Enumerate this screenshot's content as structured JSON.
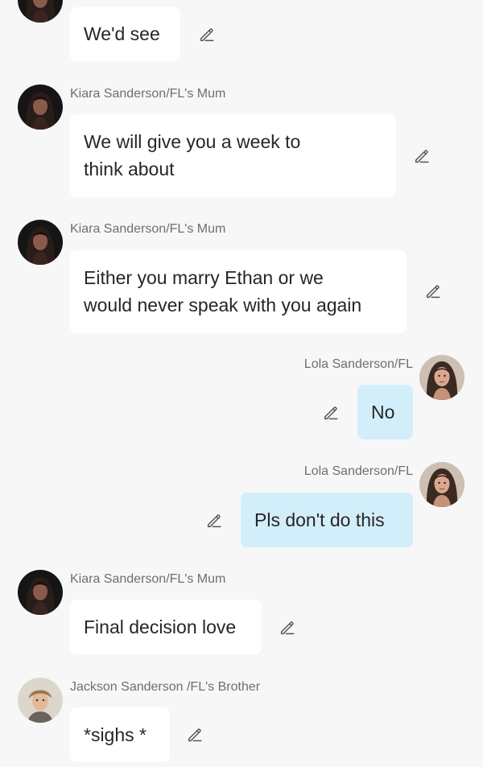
{
  "messages": [
    {
      "id": "m1",
      "side": "left",
      "sender": "",
      "text": "We'd see",
      "avatar_icon": "dark-hair-avatar-icon",
      "edit_icon": "pencil-edit-icon"
    },
    {
      "id": "m2",
      "side": "left",
      "sender": "Kiara Sanderson/FL's Mum",
      "text_lines": [
        "We will give you a week to",
        "think about"
      ],
      "avatar_icon": "dark-hair-woman-avatar-icon",
      "edit_icon": "pencil-edit-icon"
    },
    {
      "id": "m3",
      "side": "left",
      "sender": "Kiara Sanderson/FL's Mum",
      "text_lines": [
        "Either you marry Ethan or we",
        "would never speak with you again"
      ],
      "avatar_icon": "dark-hair-woman-avatar-icon",
      "edit_icon": "pencil-edit-icon"
    },
    {
      "id": "m4",
      "side": "right",
      "sender": "Lola Sanderson/FL",
      "text": "No",
      "avatar_icon": "brunette-woman-avatar-icon",
      "edit_icon": "pencil-edit-icon"
    },
    {
      "id": "m5",
      "side": "right",
      "sender": "Lola Sanderson/FL",
      "text": "Pls don't do this",
      "avatar_icon": "brunette-woman-avatar-icon",
      "edit_icon": "pencil-edit-icon"
    },
    {
      "id": "m6",
      "side": "left",
      "sender": "Kiara Sanderson/FL's Mum",
      "text": "Final decision love",
      "avatar_icon": "dark-hair-woman-avatar-icon",
      "edit_icon": "pencil-edit-icon"
    },
    {
      "id": "m7",
      "side": "left",
      "sender": "Jackson Sanderson /FL's Brother",
      "text": "*sighs *",
      "avatar_icon": "blond-man-avatar-icon",
      "edit_icon": "pencil-edit-icon"
    }
  ],
  "colors": {
    "background": "#f7f7f7",
    "bubble_other": "#ffffff",
    "bubble_self": "#d3eefb",
    "name_text": "#6f6f6f",
    "message_text": "#262626"
  }
}
